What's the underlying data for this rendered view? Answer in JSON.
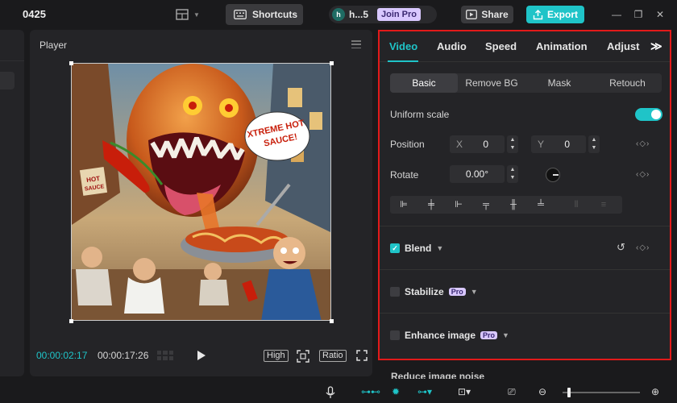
{
  "header": {
    "project_title": "0425",
    "shortcuts_label": "Shortcuts",
    "user_initial": "h",
    "user_name": "h...5",
    "join_pro_label": "Join Pro",
    "share_label": "Share",
    "export_label": "Export"
  },
  "player": {
    "title": "Player",
    "current_time": "00:00:02:17",
    "total_time": "00:00:17:26",
    "quality_label": "High",
    "ratio_label": "Ratio",
    "preview_text_sign": "XTREME HOT SAUCE!",
    "preview_text_left": "HOT SAUCE"
  },
  "inspector": {
    "tabs": [
      "Video",
      "Audio",
      "Speed",
      "Animation",
      "Adjust"
    ],
    "active_tab": "Video",
    "subtabs": [
      "Basic",
      "Remove BG",
      "Mask",
      "Retouch"
    ],
    "active_subtab": "Basic",
    "uniform_scale_label": "Uniform scale",
    "uniform_scale_on": true,
    "position_label": "Position",
    "pos_x_prefix": "X",
    "pos_x": "0",
    "pos_y_prefix": "Y",
    "pos_y": "0",
    "rotate_label": "Rotate",
    "rotate_value": "0.00°",
    "blend_label": "Blend",
    "blend_checked": true,
    "stabilize_label": "Stabilize",
    "enhance_label": "Enhance image",
    "reduce_noise_label": "Reduce image noise",
    "pro_badge": "Pro"
  },
  "colors": {
    "accent": "#1fc4c8",
    "highlight_border": "#e21a1a",
    "pro_badge_bg": "#d9c8ff"
  }
}
